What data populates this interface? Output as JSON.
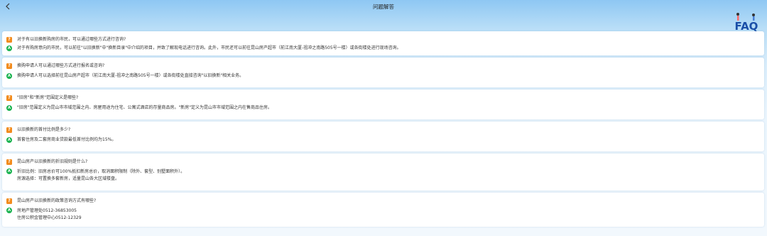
{
  "header": {
    "title": "问题解答",
    "back_icon": "chevron-left-icon",
    "logo_text": "FAQ"
  },
  "faq": [
    {
      "question": "对于有以旧换新购房的市民，可以通过哪些方式进行咨询?",
      "answer": [
        "对于有购房意向的市民，可以前往\"以旧换新\"中\"换新目录\"中介绍的项目，并致了解现电话进行咨询。此外，市民还可以前往昆山房产超市（前江南大厦-祖冲之南路505号一楼）或各街楼处进行现场咨询。"
      ]
    },
    {
      "question": "换购申请人可以通过哪些方式进行报名或咨询?",
      "answer": [
        "换购申请人可以选择前往昆山房产超市（前江南大厦-祖冲之南路505号一楼）或各街楼处直接咨询\"以旧换新\"相关业务。"
      ]
    },
    {
      "question": "\"旧房\"和\"新房\"范围定义是哪些?",
      "answer": [
        "\"旧房\"范围定义为昆山市市域范围之内、房屋用途为住宅、公寓式酒店的存量商品房。\"新房\"定义为昆山市市域范围之内在售商品住房。"
      ]
    },
    {
      "question": "以旧换新的首付比例是多少?",
      "answer": [
        "首套住房及二套房商业贷款最低首付比例均为15%。"
      ]
    },
    {
      "question": "昆山房产以旧换新的折旧规则是什么?",
      "answer": [
        "折旧比例：旧房总价可100%抵扣新房总价，取消面积限制（除外、套型、别墅面积外）。",
        "房源选择：可置换多套新房，适量昆山各大区域楼盘。"
      ]
    },
    {
      "question": "昆山房产以旧换新的政策咨询方式有哪些?",
      "answer": [
        "房地产管理处0512-36853005",
        "住房公积金管理中心0512-12329"
      ]
    }
  ],
  "colors": {
    "question_icon": "#f28c1e",
    "answer_icon": "#19b34f",
    "header_gradient_top": "#8ec7f3"
  }
}
